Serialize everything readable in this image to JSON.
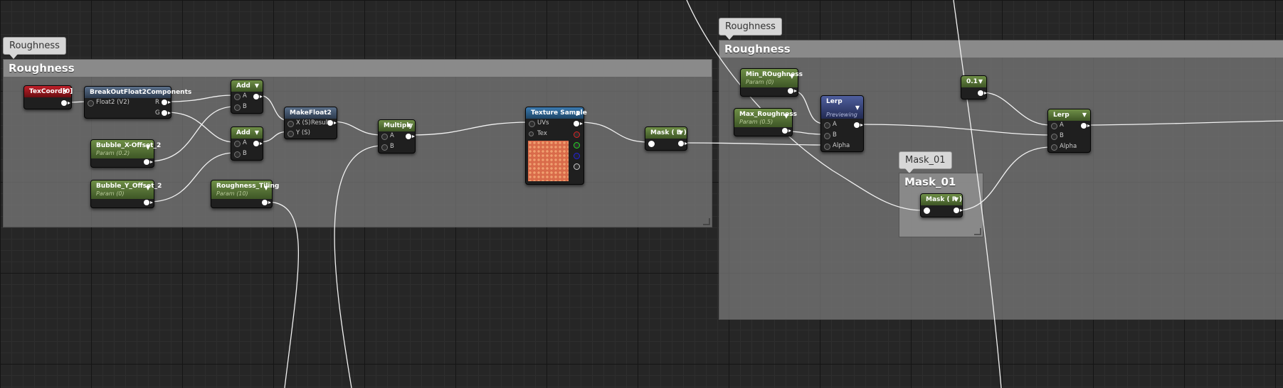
{
  "comments": {
    "left": {
      "bubble": "Roughness",
      "title": "Roughness"
    },
    "right": {
      "bubble": "Roughness",
      "title": "Roughness"
    },
    "mask": {
      "bubble": "Mask_01",
      "title": "Mask_01"
    }
  },
  "nodes": {
    "texcoord": {
      "title": "TexCoord[0]"
    },
    "breakout": {
      "title": "BreakOutFloat2Components",
      "input": "Float2 (V2)",
      "out_r": "R",
      "out_g": "G"
    },
    "add1": {
      "title": "Add",
      "in_a": "A",
      "in_b": "B"
    },
    "add2": {
      "title": "Add",
      "in_a": "A",
      "in_b": "B"
    },
    "bubble_x": {
      "title": "Bubble_X-Offset_2",
      "sub": "Param (0.2)"
    },
    "bubble_y": {
      "title": "Bubble_Y_Offset_2",
      "sub": "Param (0)"
    },
    "roughness_tiling": {
      "title": "Roughness_Tiling",
      "sub": "Param (10)"
    },
    "makefloat2": {
      "title": "MakeFloat2",
      "in_x": "X (S)",
      "in_y": "Y (S)",
      "out": "Result"
    },
    "multiply": {
      "title": "Multiply",
      "in_a": "A",
      "in_b": "B"
    },
    "texture_sample": {
      "title": "Texture Sample",
      "in_uvs": "UVs",
      "in_tex": "Tex"
    },
    "mask_b": {
      "title": "Mask ( B )"
    },
    "min_roughness": {
      "title": "Min_ROughness",
      "sub": "Param (0)"
    },
    "max_roughness": {
      "title": "Max_Roughness",
      "sub": "Param (0.5)"
    },
    "lerp1": {
      "title": "Lerp",
      "sub": "Previewing",
      "in_a": "A",
      "in_b": "B",
      "in_alpha": "Alpha"
    },
    "const": {
      "title": "0.1"
    },
    "mask_r": {
      "title": "Mask ( R )"
    },
    "lerp2": {
      "title": "Lerp",
      "in_a": "A",
      "in_b": "B",
      "in_alpha": "Alpha"
    }
  },
  "colors": {
    "param_header": "#5a7a3a",
    "texcoord_header": "#a01820",
    "texture_header": "#2f6ea0",
    "lerp_header": "#3c4a85"
  }
}
